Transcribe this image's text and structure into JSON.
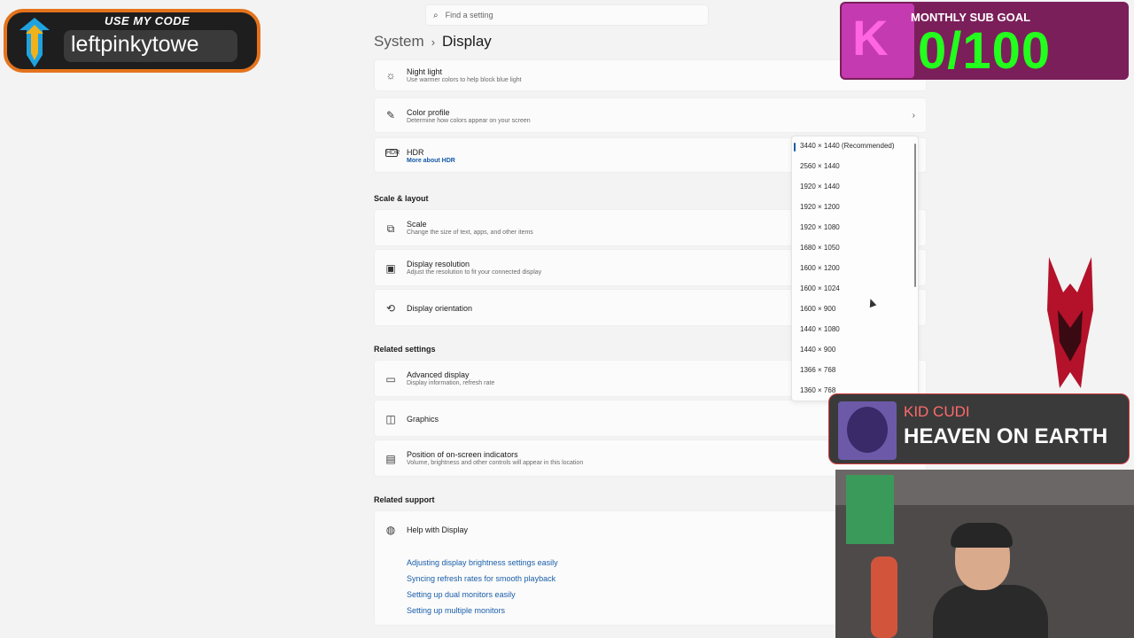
{
  "search": {
    "placeholder": "Find a setting"
  },
  "breadcrumb": {
    "parent": "System",
    "separator": "›",
    "current": "Display"
  },
  "rows": {
    "night_light": {
      "title": "Night light",
      "sub": "Use warmer colors to help block blue light"
    },
    "color_profile": {
      "title": "Color profile",
      "sub": "Determine how colors appear on your screen"
    },
    "hdr": {
      "title": "HDR",
      "link": "More about HDR"
    },
    "scale": {
      "title": "Scale",
      "sub": "Change the size of text, apps, and other items"
    },
    "resolution": {
      "title": "Display resolution",
      "sub": "Adjust the resolution to fit your connected display"
    },
    "orientation": {
      "title": "Display orientation"
    },
    "advanced": {
      "title": "Advanced display",
      "sub": "Display information, refresh rate"
    },
    "graphics": {
      "title": "Graphics"
    },
    "indicators": {
      "title": "Position of on-screen indicators",
      "sub": "Volume, brightness and other controls will appear in this location"
    },
    "help": {
      "title": "Help with Display"
    }
  },
  "sections": {
    "scale_layout": "Scale & layout",
    "related_settings": "Related settings",
    "related_support": "Related support"
  },
  "help_links": [
    "Adjusting display brightness settings easily",
    "Syncing refresh rates for smooth playback",
    "Setting up dual monitors easily",
    "Setting up multiple monitors"
  ],
  "resolution_options": [
    "3440 × 1440 (Recommended)",
    "2560 × 1440",
    "1920 × 1440",
    "1920 × 1200",
    "1920 × 1080",
    "1680 × 1050",
    "1600 × 1200",
    "1600 × 1024",
    "1600 × 900",
    "1440 × 1080",
    "1440 × 900",
    "1366 × 768",
    "1360 × 768"
  ],
  "selected_resolution": "3440 × 1440 (Recommended)",
  "overlays": {
    "code_heading": "USE MY CODE",
    "code_value": "leftpinkytowe",
    "subgoal_label": "MONTHLY SUB GOAL",
    "subgoal_value": "0/100",
    "song_artist": "KID CUDI",
    "song_title": "HEAVEN ON EARTH"
  },
  "colors": {
    "accent": "#1a5ea8",
    "code_border": "#e4731c",
    "subgoal_green": "#23ff1d",
    "song_artist": "#ff6b6b"
  },
  "icons": {
    "search": "search-icon",
    "night_light": "sun-icon",
    "color_profile": "brush-icon",
    "hdr": "hdr-icon",
    "scale": "scale-icon",
    "resolution": "resolution-icon",
    "orientation": "orientation-icon",
    "advanced": "laptop-icon",
    "graphics": "graphics-icon",
    "indicators": "indicator-icon",
    "help": "globe-icon"
  }
}
